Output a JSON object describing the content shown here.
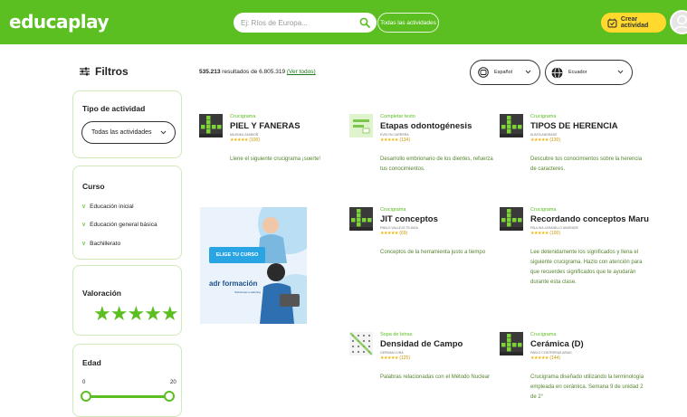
{
  "header": {
    "logo": "educaplay",
    "search_placeholder": "Ej: Ríos de Europa...",
    "all_activities_label": "Todas las actividades",
    "create_label": "Crear actividad"
  },
  "colors": {
    "brand_green": "#5bbf21",
    "accent_yellow": "#ffd92e",
    "ad_blue": "#2aa5e3"
  },
  "sidebar": {
    "title": "Filtros",
    "activity_type": {
      "title": "Tipo de actividad",
      "selected": "Todas las actividades"
    },
    "course": {
      "title": "Curso",
      "items": [
        "Educación inicial",
        "Educación general básica",
        "Bachillerato"
      ]
    },
    "rating": {
      "title": "Valoración",
      "stars": "★★★★★",
      "value": 5
    },
    "age": {
      "title": "Edad",
      "min": "0",
      "max": "20"
    }
  },
  "results": {
    "count_bold": "535.213",
    "count_text": " resultados de 6.805.319 ",
    "view_all": "(Ver todos)",
    "language": "Español",
    "country": "Ecuador"
  },
  "ad": {
    "button": "ELIGE TU CURSO",
    "brand": "adr formación",
    "tagline": "Soluciones e-learning"
  },
  "cards": [
    {
      "type": "Crucigrama",
      "title": "PIEL Y FANERAS",
      "author": "MILENKA ZAMBOÑ",
      "stars": "★★★★★",
      "count": "(100)",
      "desc": "Llene el siguiente crucigrama ¡suerte!",
      "icon": "crossword-icon"
    },
    {
      "type": "Completar texto",
      "title": "Etapas odontogénesis",
      "author": "EVELYN CARRERA",
      "stars": "★★★★★",
      "count": "(134)",
      "desc": "Desarrollo embrionario de los dientes, refuerza tus conocimientos.",
      "icon": "fill-text-icon"
    },
    {
      "type": "Crucigrama",
      "title": "TIPOS DE HERENCIA",
      "author": "ALBITA ANDRADE",
      "stars": "★★★★★",
      "count": "(130)",
      "desc": "Descubre tus conocimientos sobre la herencia de caracteres.",
      "icon": "crossword-icon"
    },
    {
      "type": "Crucigrama",
      "title": "JIT conceptos",
      "author": "PABLO VALLEJO TEJADA",
      "stars": "★★★★★",
      "count": "(69)",
      "desc": "Conceptos de la herramienta justo a tiempo",
      "icon": "crossword-icon"
    },
    {
      "type": "Crucigrama",
      "title": "Recordando conceptos Maru",
      "author": "PAULINA JARAMILLO ANDRADE",
      "stars": "★★★★★",
      "count": "(100)",
      "desc": "Lee detenidamente los significados y llena el siguiente crucigrama. Hazlo con atención para que recuerdes significados que te ayudarán durante esta clase.",
      "icon": "crossword-icon"
    },
    {
      "type": "Sopa de letras",
      "title": "Densidad de Campo",
      "author": "GERMAN LUNA",
      "stars": "★★★★★",
      "count": "(125)",
      "desc": "Palabras relacionadas con el Método Nuclear",
      "icon": "word-search-icon"
    },
    {
      "type": "Crucigrama",
      "title": "Cerámica (D)",
      "author": "PABLO CONTRERAS ARIAS",
      "stars": "★★★★★",
      "count": "(144)",
      "desc": "Crucigrama diseñado utilizando la terminología empleada en cerámica. Semana 9 de unidad 2 de 2°",
      "icon": "crossword-icon"
    }
  ]
}
